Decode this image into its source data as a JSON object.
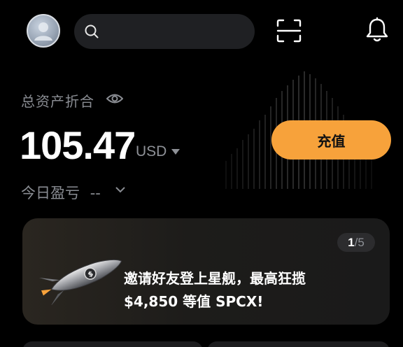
{
  "header": {
    "avatar_icon": "user-avatar",
    "search_icon": "search-icon",
    "search_placeholder": "",
    "scan_icon": "scan-icon",
    "notification_icon": "bell-icon"
  },
  "assets": {
    "label": "总资产折合",
    "visibility_icon": "eye-icon",
    "balance": "105.47",
    "currency": "USD",
    "today_pnl_label": "今日盈亏",
    "today_pnl_value": "--",
    "deposit_label": "充值"
  },
  "banner": {
    "page_current": "1",
    "page_sep_total": "/5",
    "line1": "邀请好友登上星舰，最高狂揽",
    "line2": "$4,850 等值 SPCX!",
    "image_icon": "rocket-icon"
  },
  "colors": {
    "accent": "#f7a23b",
    "background": "#000000",
    "muted_text": "#8a8d93",
    "card": "#1f2023"
  }
}
